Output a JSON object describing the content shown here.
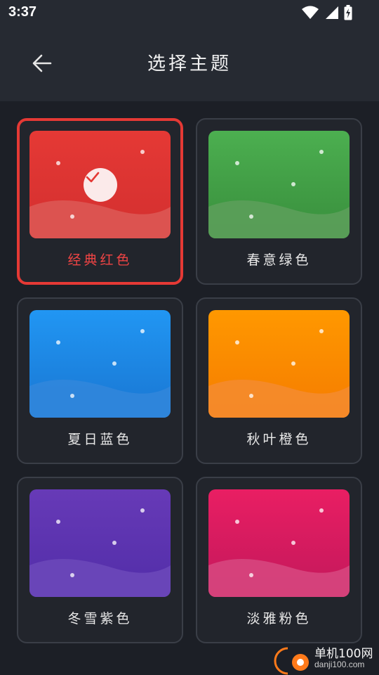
{
  "status_bar": {
    "time": "3:37",
    "icons": [
      "wifi-icon",
      "signal-icon",
      "battery-charging-icon"
    ]
  },
  "app_bar": {
    "title": "选择主题",
    "back_icon": "arrow-left-icon"
  },
  "themes": [
    {
      "label": "经典红色",
      "selected": true,
      "color_top": "#e53935",
      "color_bottom": "#d32f2f",
      "wave": "#dc5552"
    },
    {
      "label": "春意绿色",
      "selected": false,
      "color_top": "#4caf50",
      "color_bottom": "#388e3c",
      "wave": "#5a9e58"
    },
    {
      "label": "夏日蓝色",
      "selected": false,
      "color_top": "#2196f3",
      "color_bottom": "#1976d2",
      "wave": "#2f86db"
    },
    {
      "label": "秋叶橙色",
      "selected": false,
      "color_top": "#ff9800",
      "color_bottom": "#f57c00",
      "wave": "#f48a2a"
    },
    {
      "label": "冬雪紫色",
      "selected": false,
      "color_top": "#673ab7",
      "color_bottom": "#512da8",
      "wave": "#6a47b8"
    },
    {
      "label": "淡雅粉色",
      "selected": false,
      "color_top": "#e91e63",
      "color_bottom": "#c2185b",
      "wave": "#d6437c"
    }
  ],
  "watermark": {
    "title": "单机100网",
    "url": "danji100.com"
  }
}
